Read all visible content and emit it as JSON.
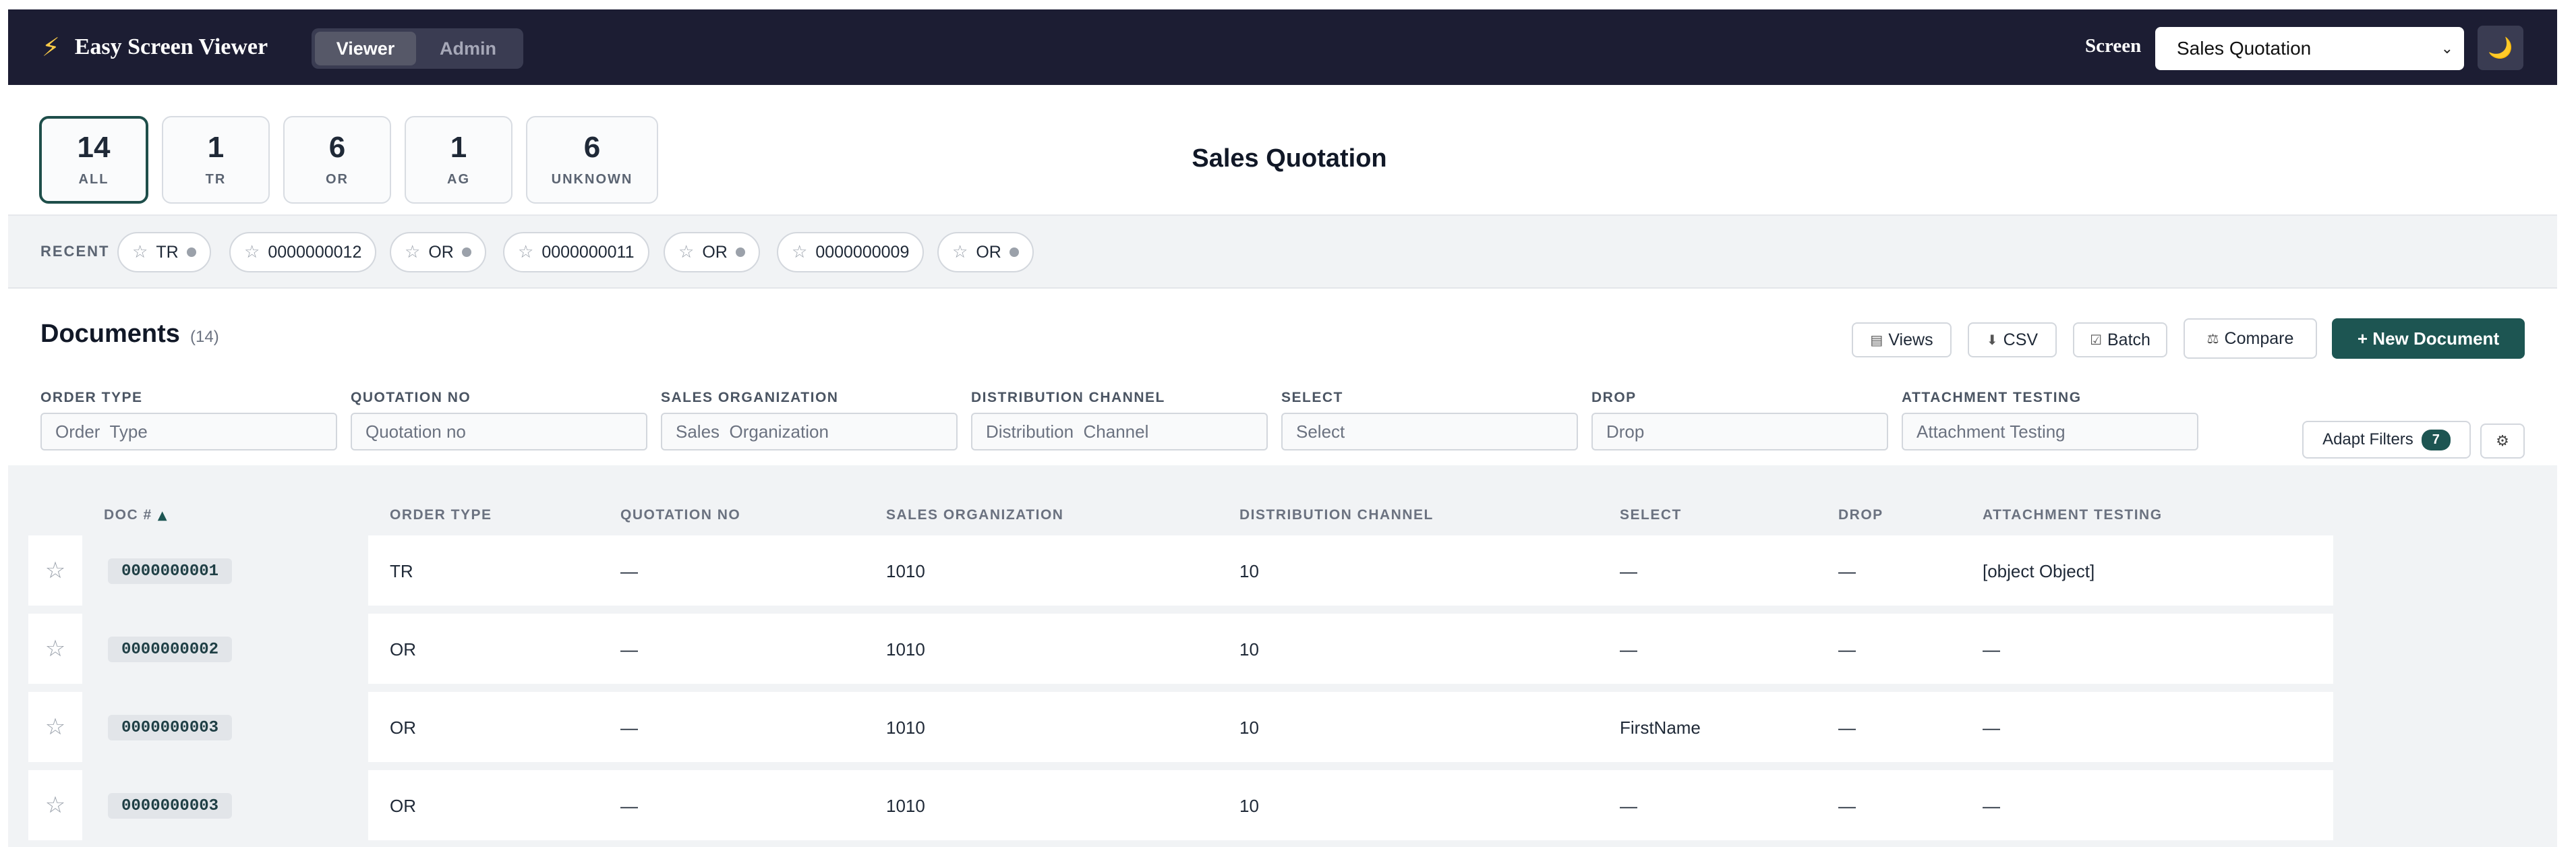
{
  "app": {
    "title": "Easy Screen Viewer",
    "bolt_icon": "⚡"
  },
  "mode_toggle": {
    "viewer": "Viewer",
    "admin": "Admin",
    "active": "Viewer"
  },
  "screen": {
    "label": "Screen",
    "selected": "Sales Quotation"
  },
  "theme_icon": "🌙",
  "stats": [
    {
      "num": "14",
      "label": "ALL"
    },
    {
      "num": "1",
      "label": "TR"
    },
    {
      "num": "6",
      "label": "OR"
    },
    {
      "num": "1",
      "label": "AG"
    },
    {
      "num": "6",
      "label": "UNKNOWN"
    }
  ],
  "page_title": "Sales Quotation",
  "recent": {
    "label": "RECENT",
    "items": [
      "TR",
      "0000000012",
      "OR",
      "0000000011",
      "OR",
      "0000000009",
      "OR"
    ]
  },
  "documents": {
    "title": "Documents",
    "count": "(14)",
    "views": "Views",
    "csv": "CSV",
    "batch": "Batch",
    "compare": "Compare",
    "new": "+ New Document"
  },
  "filters": [
    {
      "label": "ORDER TYPE",
      "placeholder": "Order  Type"
    },
    {
      "label": "QUOTATION NO",
      "placeholder": "Quotation no"
    },
    {
      "label": "SALES ORGANIZATION",
      "placeholder": "Sales  Organization"
    },
    {
      "label": "DISTRIBUTION CHANNEL",
      "placeholder": "Distribution  Channel"
    },
    {
      "label": "SELECT",
      "placeholder": "Select"
    },
    {
      "label": "DROP",
      "placeholder": "Drop"
    },
    {
      "label": "ATTACHMENT TESTING",
      "placeholder": "Attachment Testing"
    }
  ],
  "adapt_filters": {
    "label": "Adapt Filters",
    "badge": "7"
  },
  "table": {
    "headers": [
      "DOC #",
      "ORDER TYPE",
      "QUOTATION NO",
      "SALES ORGANIZATION",
      "DISTRIBUTION CHANNEL",
      "SELECT",
      "DROP",
      "ATTACHMENT TESTING"
    ],
    "sort_indicator": "▲",
    "rows": [
      [
        "0000000001",
        "TR",
        "—",
        "1010",
        "10",
        "—",
        "—",
        "[object Object]"
      ],
      [
        "0000000002",
        "OR",
        "—",
        "1010",
        "10",
        "—",
        "—",
        "—"
      ],
      [
        "0000000003",
        "OR",
        "—",
        "1010",
        "10",
        "FirstName",
        "—",
        "—"
      ],
      [
        "0000000003",
        "OR",
        "—",
        "1010",
        "10",
        "—",
        "—",
        "—"
      ]
    ]
  },
  "colors": {
    "header_bg": "#1c1d33",
    "accent": "#1d5552",
    "brand_icon": "#f7c948"
  }
}
